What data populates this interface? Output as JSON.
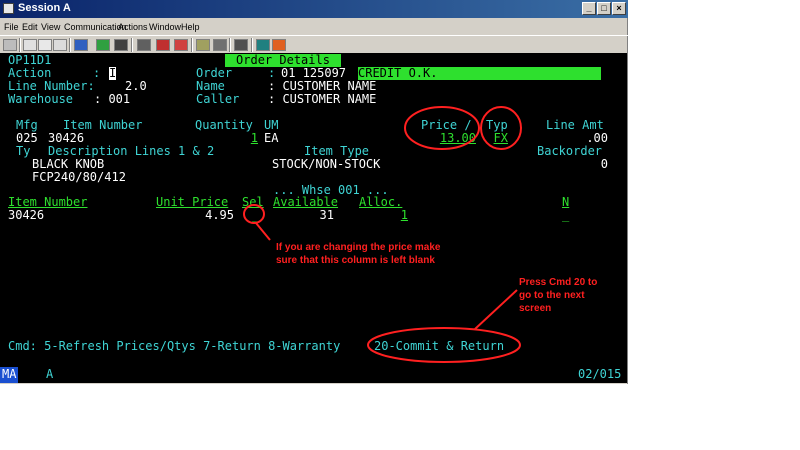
{
  "window": {
    "title": "Session A",
    "min": "_",
    "max": "□",
    "close": "×"
  },
  "menu": [
    "File",
    "Edit",
    "View",
    "Communication",
    "Actions",
    "Window",
    "Help"
  ],
  "toolbar_icons": [
    "print-screen-icon",
    "copy-icon",
    "paste-icon",
    "select-all-icon",
    "send-icon",
    "receive-icon",
    "display-icon",
    "macro-record-icon",
    "macro-stop-icon",
    "macro-play-icon",
    "settings-icon",
    "keyboard-icon",
    "disconnect-icon",
    "help-icon",
    "globe-icon",
    "edit-icon"
  ],
  "screen": {
    "program": "OP11D1",
    "title": "Order Details",
    "action_label": "Action",
    "action_value": "I",
    "order_label": "Order",
    "order_value": "01 125097",
    "credit_status": "CREDIT O.K.",
    "line_number_label": "Line Number:",
    "line_number_value": "2.0",
    "name_label": "Name",
    "name_value": ": CUSTOMER NAME",
    "warehouse_label": "Warehouse",
    "warehouse_value": ": 001",
    "caller_label": "Caller",
    "caller_value": ": CUSTOMER NAME",
    "headers1": {
      "mfg": "Mfg",
      "item_number": "Item Number",
      "quantity": "Quantity",
      "um": "UM",
      "price": "Price /",
      "typ": "Typ",
      "line_amt": "Line Amt"
    },
    "row1": {
      "mfg": "025",
      "item": "30426",
      "quantity": "1",
      "um": "EA",
      "price": "13.00",
      "typ": "FX",
      "line_amt": ".00"
    },
    "headers2": {
      "ty": "Ty",
      "description": "Description Lines 1 & 2",
      "item_type": "Item Type",
      "backorder": "Backorder"
    },
    "row2": {
      "desc1": "BLACK KNOB",
      "item_type": "STOCK/NON-STOCK",
      "backorder": "0",
      "desc2": "FCP240/80/412"
    },
    "whse_label": "... Whse 001 ...",
    "headers3": {
      "item_number": "Item Number",
      "unit_price": "Unit Price",
      "sel": "Sel",
      "available": "Available",
      "alloc": "Alloc.",
      "n": "N"
    },
    "row3": {
      "item": "30426",
      "unit_price": "4.95",
      "sel": "_",
      "available": "31",
      "alloc": "1",
      "n": "_"
    },
    "cmd_line": "Cmd: 5-Refresh Prices/Qtys 7-Return 8-Warranty",
    "cmd_commit": "20-Commit & Return"
  },
  "status": {
    "mode": "MA",
    "indicator": "A",
    "position": "02/015"
  },
  "annotations": {
    "price_note": [
      "If you are changing the price make",
      "sure that this column is left blank"
    ],
    "cmd_note": [
      "Press Cmd 20 to",
      "go to the next",
      "screen"
    ]
  },
  "colors": {
    "annotation": "#ff2020",
    "terminal_bg": "#000000",
    "terminal_text": "#3fd4d4",
    "terminal_green": "#2ee02e"
  }
}
